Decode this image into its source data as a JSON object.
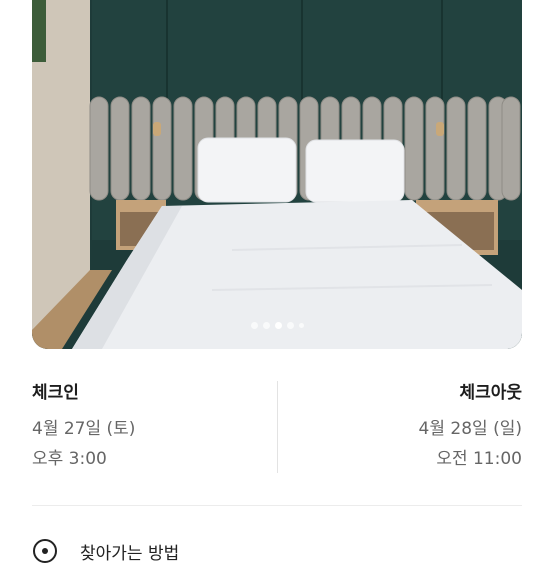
{
  "gallery": {
    "dots": [
      {
        "state": "inactive"
      },
      {
        "state": "inactive"
      },
      {
        "state": "active"
      },
      {
        "state": "inactive"
      },
      {
        "state": "inactive-small"
      }
    ]
  },
  "checkin": {
    "title": "체크인",
    "date": "4월 27일 (토)",
    "time": "오후 3:00"
  },
  "checkout": {
    "title": "체크아웃",
    "date": "4월 28일 (일)",
    "time": "오전 11:00"
  },
  "next_section": {
    "label": "찾아가는 방법"
  }
}
